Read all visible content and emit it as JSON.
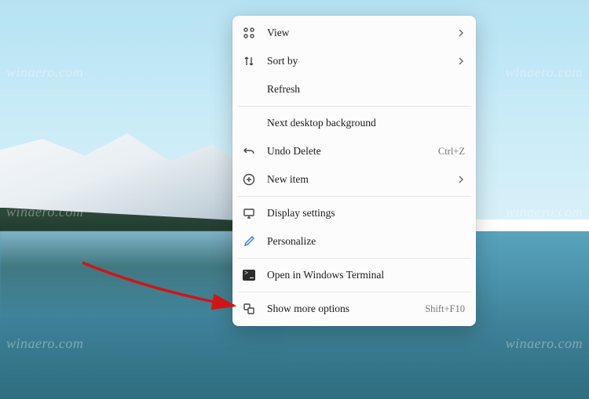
{
  "watermark": "winaero.com",
  "menu": {
    "view": {
      "label": "View"
    },
    "sort": {
      "label": "Sort by"
    },
    "refresh": {
      "label": "Refresh"
    },
    "nextbg": {
      "label": "Next desktop background"
    },
    "undo": {
      "label": "Undo Delete",
      "shortcut": "Ctrl+Z"
    },
    "newitem": {
      "label": "New item"
    },
    "display": {
      "label": "Display settings"
    },
    "personalize": {
      "label": "Personalize"
    },
    "terminal": {
      "label": "Open in Windows Terminal"
    },
    "more": {
      "label": "Show more options",
      "shortcut": "Shift+F10"
    }
  }
}
